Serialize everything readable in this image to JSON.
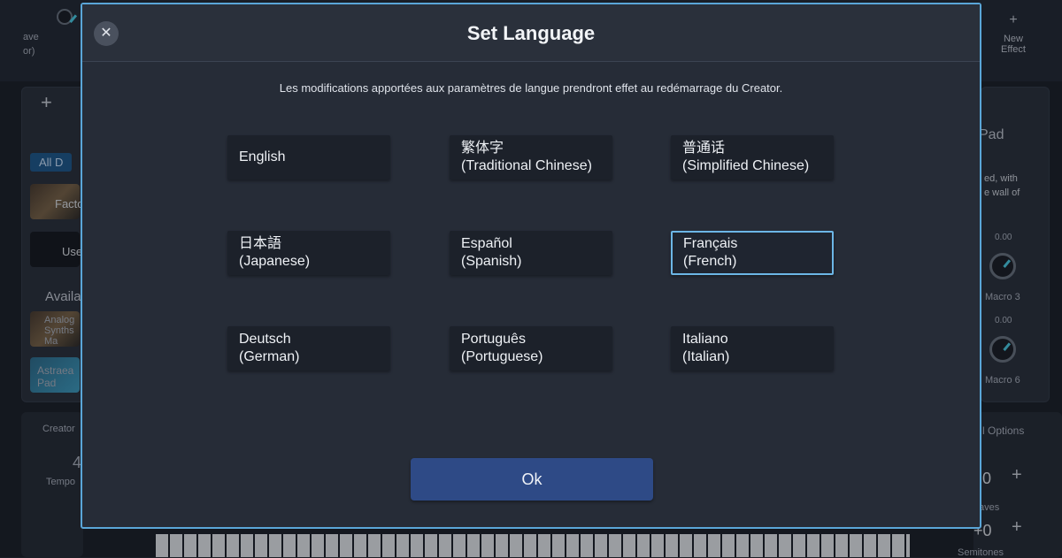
{
  "background": {
    "top_left_label_1": "ave",
    "top_left_label_2": "or)",
    "new_effect_label": "New\nEffect",
    "all_chip": "All D",
    "row_factory": "Facto",
    "row_user": "Use",
    "available": "Availa",
    "analog_label": "Analog\nSynths\nMa",
    "astraea_label": "Astraea\nPad",
    "creator_label": "Creator",
    "tempo_label": "Tempo",
    "tempo_value": "4",
    "pad_label": "Pad",
    "pad_desc": "ed, with\ne wall of",
    "macro3_value": "0.00",
    "macro3_label": "Macro 3",
    "macro6_value": "0.00",
    "macro6_label": "Macro 6",
    "options_label": "l Options",
    "octaves_value": "0",
    "octaves_label": "aves",
    "semitones_value": "+0",
    "semitones_label": "Semitones"
  },
  "dialog": {
    "title": "Set Language",
    "close_glyph": "✕",
    "notice": "Les modifications apportées aux paramètres de langue prendront effet au redémarrage du Creator.",
    "languages": [
      {
        "native": "English",
        "english": ""
      },
      {
        "native": "繁体字",
        "english": "(Traditional Chinese)"
      },
      {
        "native": "普通话",
        "english": "(Simplified Chinese)"
      },
      {
        "native": "日本語",
        "english": "(Japanese)"
      },
      {
        "native": "Español",
        "english": "(Spanish)"
      },
      {
        "native": "Français",
        "english": "(French)",
        "selected": true
      },
      {
        "native": "Deutsch",
        "english": "(German)"
      },
      {
        "native": "Português",
        "english": "(Portuguese)"
      },
      {
        "native": "Italiano",
        "english": "(Italian)"
      }
    ],
    "ok_label": "Ok"
  },
  "colors": {
    "accent_border": "#5aa6d8",
    "ok_button": "#2e4a86",
    "selected_border": "#6cb6e6"
  }
}
